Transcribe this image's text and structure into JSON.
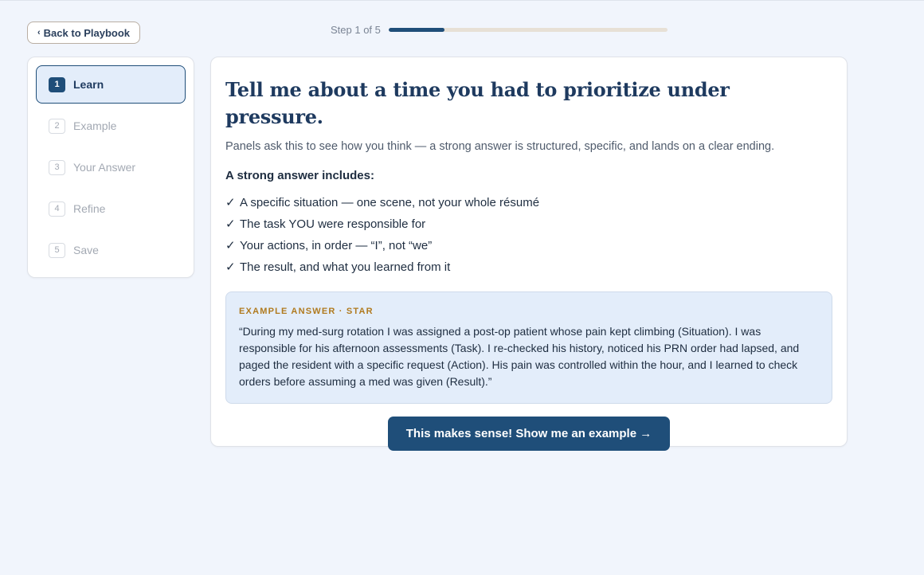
{
  "nav": {
    "back_label": "Back to Playbook"
  },
  "progress": {
    "label": "Step 1 of 5",
    "current": 1,
    "total": 5,
    "fraction": 0.2
  },
  "steps": [
    {
      "num": "1",
      "label": "Learn",
      "active": true
    },
    {
      "num": "2",
      "label": "Example",
      "active": false
    },
    {
      "num": "3",
      "label": "Your Answer",
      "active": false
    },
    {
      "num": "4",
      "label": "Refine",
      "active": false
    },
    {
      "num": "5",
      "label": "Save",
      "active": false
    }
  ],
  "main": {
    "title": "Tell me about a time you had to prioritize under pressure.",
    "subtitle": "Panels ask this to see how you think — a strong answer is structured, specific, and lands on a clear ending.",
    "includes_title": "A strong answer includes:",
    "checklist": [
      "A specific situation — one scene, not your whole résumé",
      "The task YOU were responsible for",
      "Your actions, in order — “I”, not “we”",
      "The result, and what you learned from it"
    ],
    "example": {
      "label": "EXAMPLE ANSWER · STAR",
      "text": "“During my med-surg rotation I was assigned a post-op patient whose pain kept climbing (Situation). I was responsible for his afternoon assessments (Task). I re-checked his history, noticed his PRN order had lapsed, and paged the resident with a specific request (Action). His pain was controlled within the hour, and I learned to check orders before assuming a med was given (Result).”"
    },
    "cta_label": "This makes sense! Show me an example →"
  },
  "colors": {
    "accent": "#1f4e79",
    "example_label": "#b07a1e",
    "example_bg": "#e3edfa"
  }
}
